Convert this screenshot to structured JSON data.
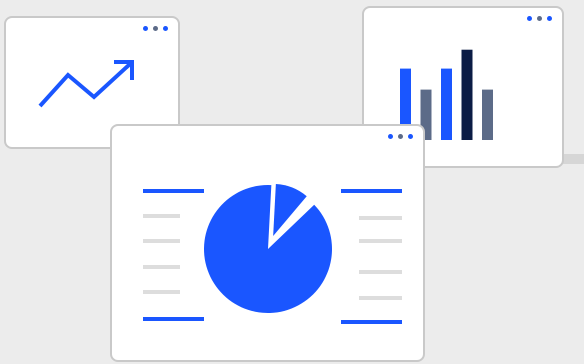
{
  "colors": {
    "accent": "#1a56ff",
    "navy": "#0b1c45",
    "slate": "#5c6b88",
    "light_line": "#dddddd",
    "dots": [
      "#1a56ff",
      "#5c6b88",
      "#1a56ff"
    ]
  },
  "icons": {
    "trend": "trend-up-arrow-icon",
    "menu": "more-dots-icon"
  },
  "bar_card": {
    "bar_levels": [
      0.68,
      0.48,
      0.68,
      0.86,
      0.48
    ],
    "bar_colors": [
      "accent",
      "slate",
      "accent",
      "navy",
      "slate"
    ]
  },
  "pie_card": {
    "slices": [
      {
        "fraction": 0.88,
        "color": "accent",
        "exploded": false
      },
      {
        "fraction": 0.12,
        "color": "accent",
        "exploded": true
      }
    ]
  }
}
